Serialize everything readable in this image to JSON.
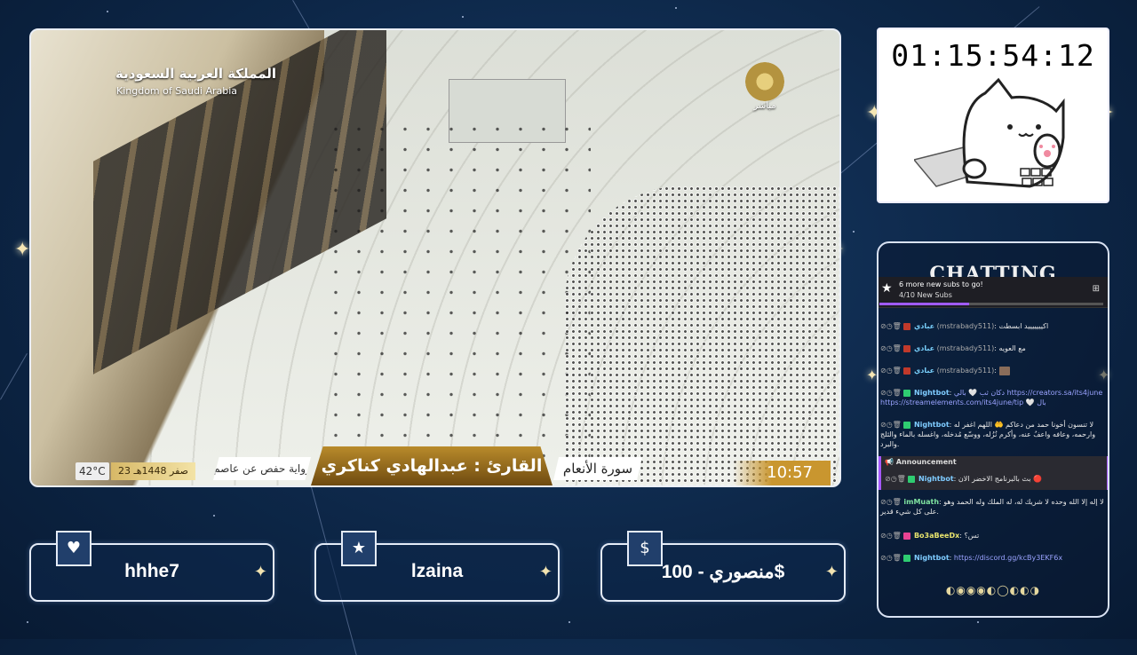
{
  "video": {
    "watermark_ar": "المملكة العربية السعودية",
    "watermark_en": "Kingdom of Saudi Arabia",
    "channel_live": "مباشر",
    "temperature": "42°C",
    "date": "23 صفر 1448هـ",
    "narration": "رواية حفص عن عاصم",
    "reader": "القارئ : عبدالهادي كناكري",
    "surah": "سورة الأنعام",
    "clock": "10:57"
  },
  "timer": {
    "value": "01:15:54:12"
  },
  "chat": {
    "title": "CHATTING",
    "goal": {
      "line1": "6 more new subs to go!",
      "line2": "4/10 New Subs",
      "progress": 0.4
    },
    "messages": [
      {
        "name": "عبادي",
        "user": "(mstrabady511)",
        "text": "اكيييييييد ابسطت",
        "name_color": "#7bd3ff"
      },
      {
        "name": "عبادي",
        "user": "(mstrabady511)",
        "text": "مع العويه",
        "name_color": "#7bd3ff"
      },
      {
        "name": "عبادي",
        "user": "(mstrabady511)",
        "text": "",
        "name_color": "#7bd3ff"
      },
      {
        "name": "Nightbot",
        "text": "دكان ثب 🤍 بالي https://creators.sa/its4june",
        "text2": "https://streamelements.com/its4june/tip 🤍 بال",
        "name_color": "#7ecbff"
      },
      {
        "name": "Nightbot",
        "text": "لا تنسون أخونا حمد من دعاكم 🤲 اللهم اغفر له",
        "text2": "وارحمه، وعافه واعفُ عنه، وأكرم نُزُله، ووسّع مُدخله، واغسله بالماء والثلج والبرد.",
        "name_color": "#7ecbff"
      }
    ],
    "announcement": {
      "header": "Announcement",
      "name": "Nightbot",
      "text": "بث بالبرنامج الاخضر الان 🔴"
    },
    "messages2": [
      {
        "name": "imMuath",
        "text": "لا إله إلا الله وحده لا شريك له، له الملك وله الحمد وهو",
        "text2": "على كل شيء قدير.",
        "name_color": "#7fe3a0"
      },
      {
        "name": "Bo3aBeeDx",
        "text": "تس؟",
        "name_color": "#e8e36d"
      },
      {
        "name": "Nightbot",
        "text": "https://discord.gg/kcBy3EKF6x",
        "name_color": "#7ecbff"
      }
    ],
    "pager": "◐◉◉◉◐◯◐◐◑"
  },
  "alerts": [
    {
      "icon": "♥",
      "name": "hhhe7"
    },
    {
      "icon": "★",
      "name": "lzaina"
    },
    {
      "icon": "$",
      "name": "منصوري - 100$"
    }
  ]
}
